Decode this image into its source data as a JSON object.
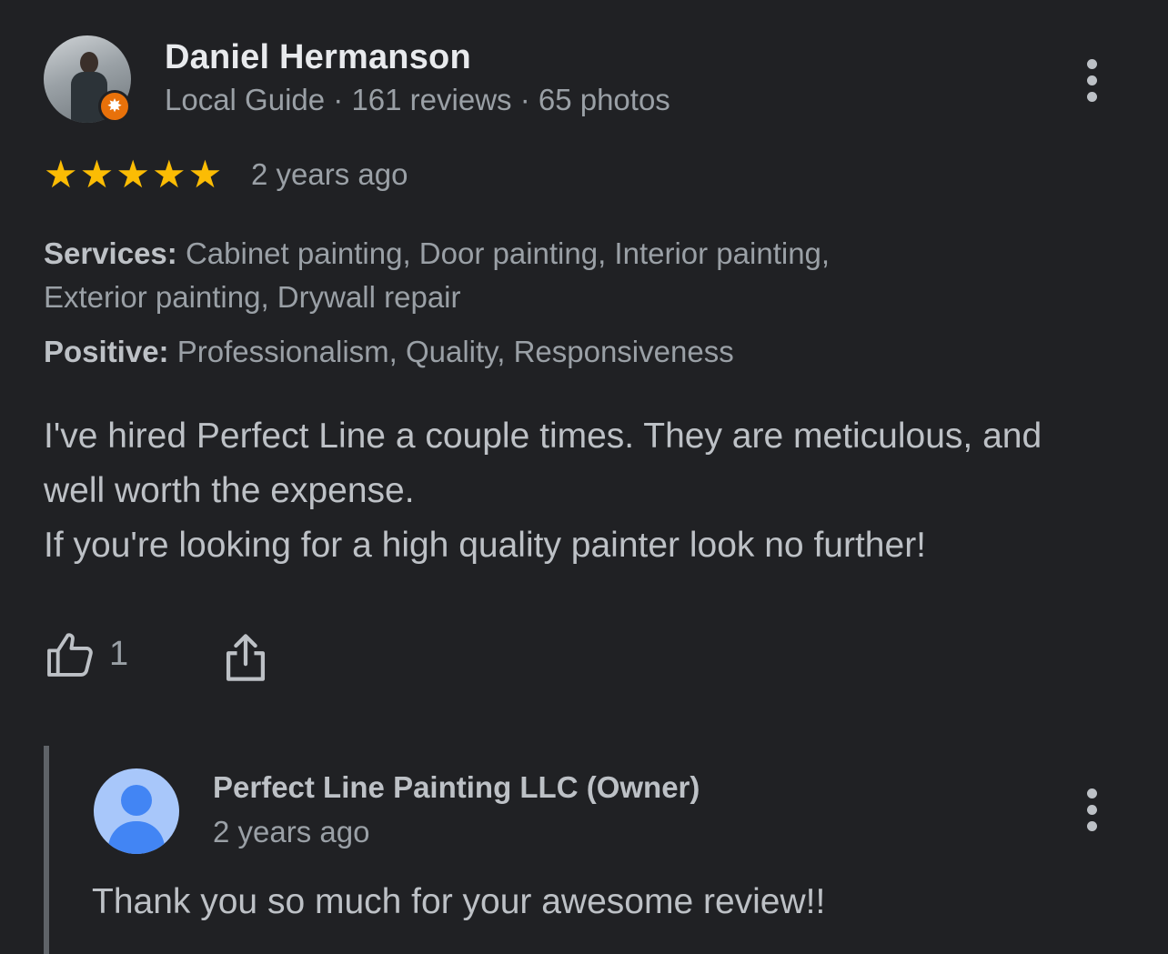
{
  "review": {
    "reviewer_name": "Daniel Hermanson",
    "reviewer_meta": "Local Guide · 161 reviews · 65 photos",
    "rating": 5,
    "date": "2 years ago",
    "services_label": "Services:",
    "services_value": "Cabinet painting, Door painting, Interior painting, Exterior painting, Drywall repair",
    "positive_label": "Positive:",
    "positive_value": "Professionalism, Quality, Responsiveness",
    "text_line1": "I've hired Perfect Line a couple times. They are meticulous, and well worth the expense.",
    "text_line2": "If you're looking for a high quality painter look no further!",
    "like_count": "1"
  },
  "owner_reply": {
    "name": "Perfect Line Painting LLC (Owner)",
    "date": "2 years ago",
    "text": "Thank you so much for your awesome review!!"
  },
  "icons": {
    "more": "more-vert-icon",
    "like": "thumb-up-icon",
    "share": "share-icon",
    "star": "star-icon",
    "badge": "local-guide-badge-icon"
  },
  "colors": {
    "background": "#202124",
    "star": "#fbbc04",
    "badge": "#e8710a",
    "owner_avatar": "#4285f4"
  }
}
